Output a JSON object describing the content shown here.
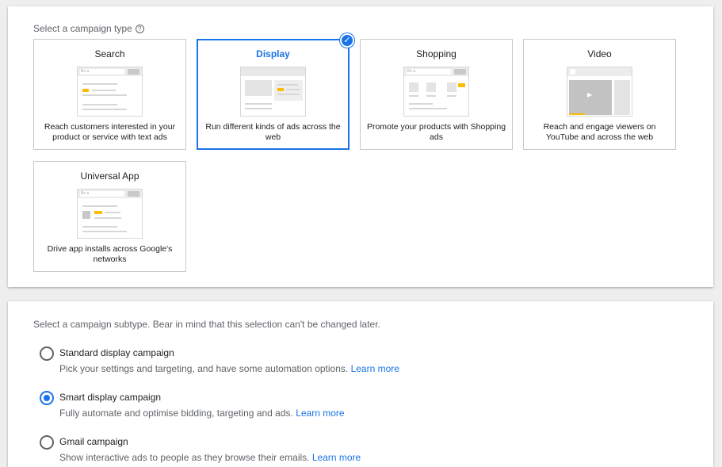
{
  "campaign_type": {
    "label": "Select a campaign type",
    "help_icon": "help-circle-icon",
    "help_glyph": "?",
    "check_glyph": "✓",
    "selected": "Display",
    "cards": [
      {
        "title": "Search",
        "description": "Reach customers interested in your product or service with text ads",
        "thumbnail_addr": "Bo a"
      },
      {
        "title": "Display",
        "description": "Run different kinds of ads across the web"
      },
      {
        "title": "Shopping",
        "description": "Promote your products with Shopping ads",
        "thumbnail_addr": "Bo a"
      },
      {
        "title": "Video",
        "description": "Reach and engage viewers on YouTube and across the web",
        "thumbnail_play": "▶"
      },
      {
        "title": "Universal App",
        "description": "Drive app installs across Google's networks",
        "thumbnail_addr": "Bo a"
      }
    ]
  },
  "campaign_subtype": {
    "label": "Select a campaign subtype. Bear in mind that this selection can't be changed later.",
    "learn_more": "Learn more",
    "options": [
      {
        "title": "Standard display campaign",
        "description": "Pick your settings and targeting, and have some automation options.",
        "selected": false
      },
      {
        "title": "Smart display campaign",
        "description": "Fully automate and optimise bidding, targeting and ads.",
        "selected": true
      },
      {
        "title": "Gmail campaign",
        "description": "Show interactive ads to people as they browse their emails.",
        "selected": false
      }
    ]
  },
  "colors": {
    "accent": "#1a73e8",
    "ad_highlight": "#fbbc04",
    "border": "#c8c8c8"
  }
}
